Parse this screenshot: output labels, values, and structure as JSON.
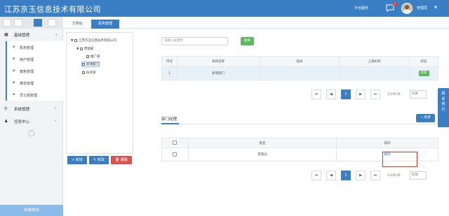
{
  "app": {
    "title": "江苏京玉信息技术有限公司",
    "platform_service": "平台服务",
    "message_badge": "1",
    "username": "管理员"
  },
  "sidebar": {
    "section_basic": "基础管理",
    "items": [
      {
        "label": "机构管理",
        "icon": "org-icon"
      },
      {
        "label": "用户管理",
        "icon": "users-icon"
      },
      {
        "label": "角色管理",
        "icon": "role-icon"
      },
      {
        "label": "菜单管理",
        "icon": "menu-icon"
      },
      {
        "label": "员工组管理",
        "icon": "group-icon"
      }
    ],
    "section_system": "系统管理",
    "section_task": "任务中心",
    "system_experience": "系统体验"
  },
  "tabs": [
    {
      "label": "工作台"
    },
    {
      "label": "机构管理"
    }
  ],
  "tree": {
    "root": "江苏京玉信息技术有限公司",
    "n1": "营销部",
    "n1a": "推广部",
    "n2": "新增部门",
    "n3": "技术部"
  },
  "tree_buttons": {
    "add": "+ 新增",
    "edit": "✎ 修改",
    "delete": "🗑 删除"
  },
  "search": {
    "placeholder": "请输入关键字",
    "button": "查询"
  },
  "org_table": {
    "headers": [
      "序号",
      "机构名称",
      "描述",
      "上级机构",
      "状态"
    ],
    "rows": [
      {
        "no": "1",
        "name": "新增部门",
        "desc": "",
        "parent": "",
        "status": "有效"
      }
    ]
  },
  "pager1": {
    "current": "1",
    "info": "1/1共1条",
    "size": "5/页"
  },
  "dept": {
    "title": "部门经理",
    "add": "+ 新增",
    "headers": [
      "姓名",
      "操作"
    ],
    "rows": [
      {
        "name": "管理员",
        "action": "删除"
      }
    ]
  },
  "pager2": {
    "current": "1",
    "info": "1/1共1条",
    "size": "5/页"
  },
  "contact": {
    "label": "联系我们"
  }
}
